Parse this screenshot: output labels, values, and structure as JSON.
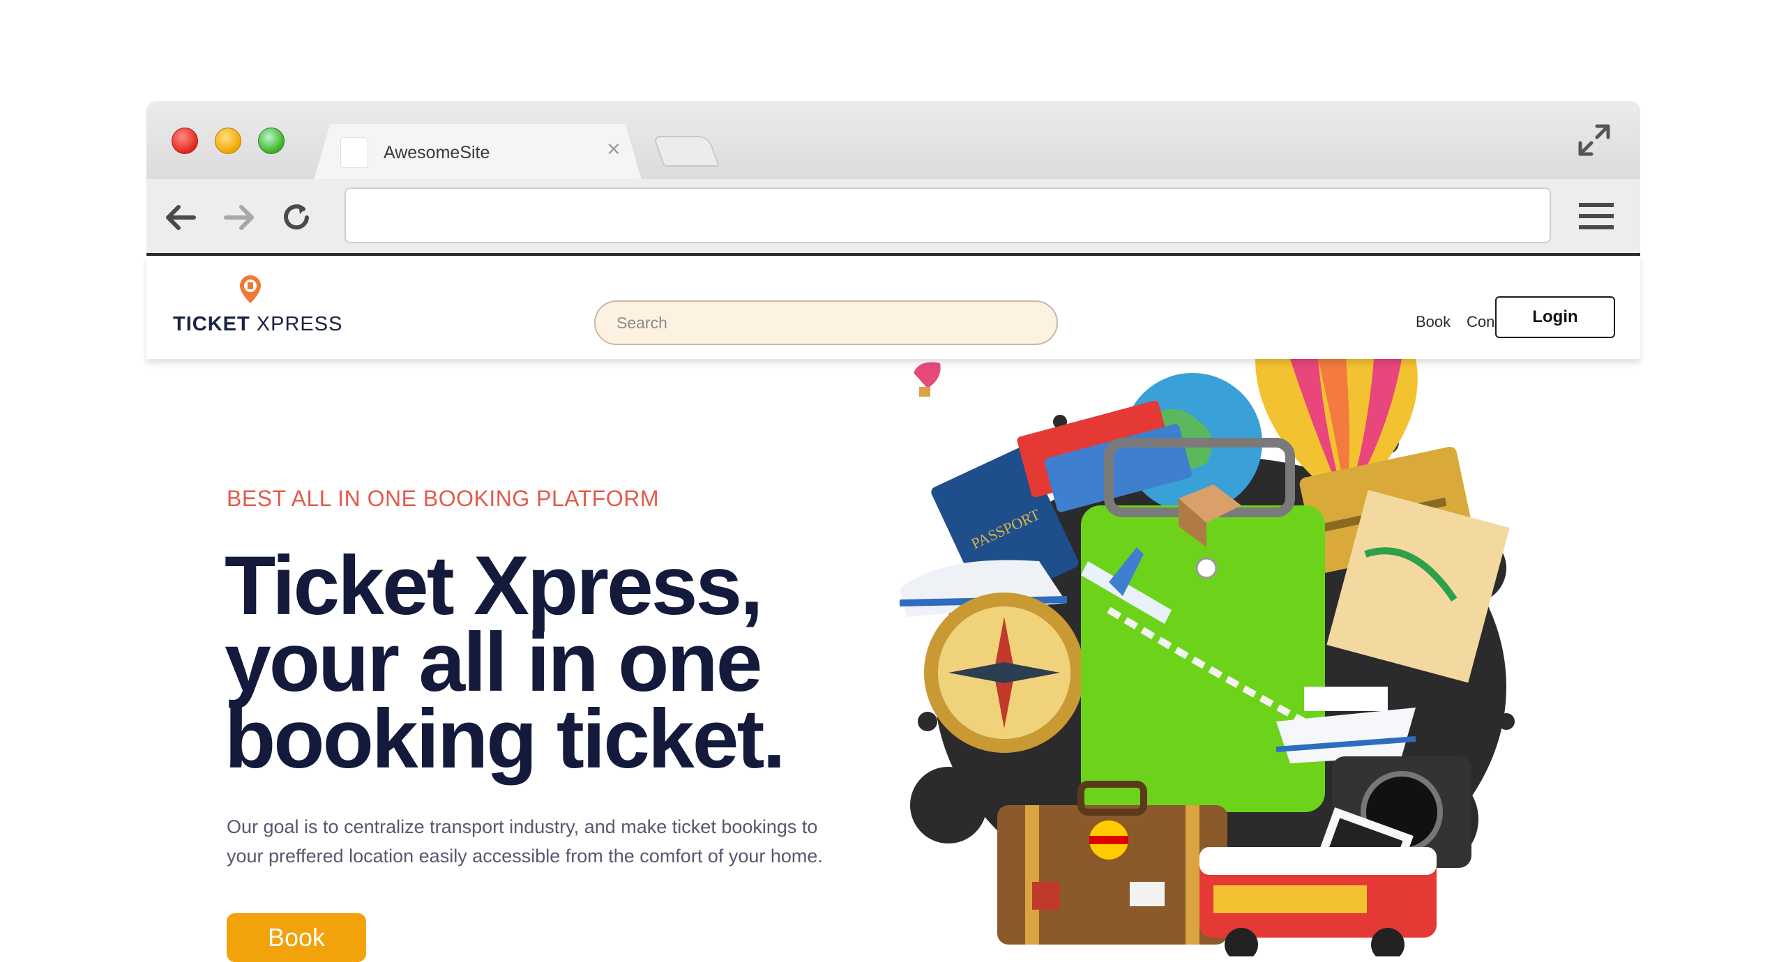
{
  "browser": {
    "tab_title": "AwesomeSite",
    "tab_close": "×",
    "address": ""
  },
  "header": {
    "logo_bold": "TICKET",
    "logo_light": " XPRESS",
    "search_placeholder": "Search",
    "nav": [
      "Book",
      "Contact Us"
    ],
    "login_label": "Login"
  },
  "hero": {
    "tagline": "BEST ALL IN ONE BOOKING PLATFORM",
    "title_lines": [
      "Ticket Xpress,",
      "your all in one",
      "booking ticket."
    ],
    "description": "Our goal is to centralize transport industry, and make ticket bookings to your preffered location easily accessible from the comfort of your home.",
    "book_label": "Book"
  },
  "colors": {
    "accent": "#f2a20a",
    "tagline": "#e35a4b",
    "title": "#141a3c",
    "search_bg": "#fdf1e2"
  },
  "icons": [
    "back-arrow-icon",
    "forward-arrow-icon",
    "reload-icon",
    "menu-icon",
    "fullscreen-icon",
    "location-pin-icon",
    "travel-illustration"
  ]
}
